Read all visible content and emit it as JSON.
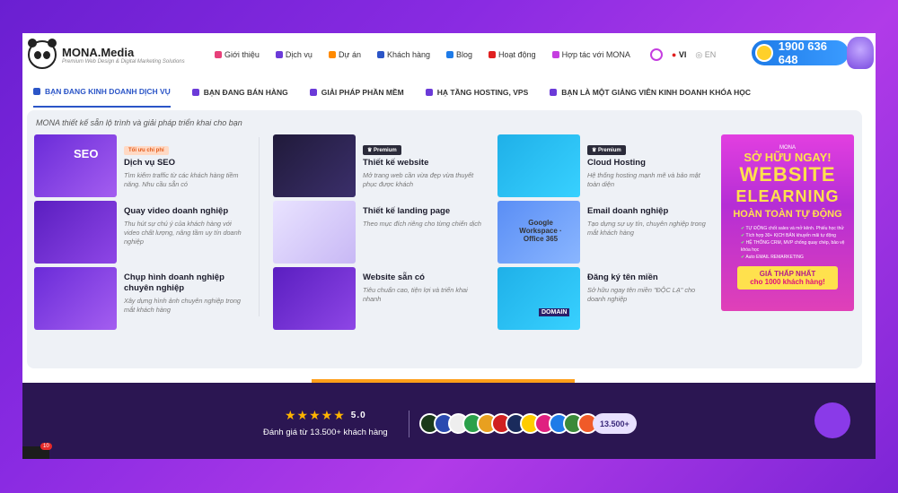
{
  "brand": {
    "name": "MONA",
    "suffix": ".Media",
    "tagline": "Premium Web Design & Digital Marketing Solutions"
  },
  "nav": [
    {
      "label": "Giới thiệu",
      "color": "#e7407a"
    },
    {
      "label": "Dịch vụ",
      "color": "#6b3ad8"
    },
    {
      "label": "Dự án",
      "color": "#ff8a00"
    },
    {
      "label": "Khách hàng",
      "color": "#2b55c7"
    },
    {
      "label": "Blog",
      "color": "#1e7be8"
    },
    {
      "label": "Hoạt động",
      "color": "#e02020"
    },
    {
      "label": "Hợp tác với MONA",
      "color": "#c53ee0"
    }
  ],
  "lang": {
    "vi": "VI",
    "en": "EN"
  },
  "hotline": "1900 636 648",
  "tabs": [
    "BẠN ĐANG KINH DOANH DỊCH VỤ",
    "BẠN ĐANG BÁN HÀNG",
    "GIẢI PHÁP PHẦN MỀM",
    "HẠ TẦNG HOSTING, VPS",
    "BẠN LÀ MỘT GIẢNG VIÊN KINH DOANH KHÓA HỌC"
  ],
  "intro": "MONA thiết kế sẵn lộ trình và giải pháp triển khai cho bạn",
  "col1": [
    {
      "badge": "Tối ưu chi phí",
      "title": "Dịch vụ SEO",
      "desc": "Tìm kiếm traffic từ các khách hàng tiềm năng. Nhu cầu sẵn có",
      "thumb_text": "SEO"
    },
    {
      "title": "Quay video doanh nghiệp",
      "desc": "Thu hút sự chú ý của khách hàng với video chất lượng, nâng tầm uy tín doanh nghiệp"
    },
    {
      "title": "Chụp hình doanh nghiệp chuyên nghiệp",
      "desc": "Xây dựng hình ảnh chuyên nghiệp trong mắt khách hàng"
    }
  ],
  "col2": [
    {
      "badge": "Premium",
      "title": "Thiết kế website",
      "desc": "Mở trang web cần vừa đẹp vừa thuyết phục được khách"
    },
    {
      "title": "Thiết kế landing page",
      "desc": "Theo mục đích riêng cho từng chiến dịch"
    },
    {
      "title": "Website sẵn có",
      "desc": "Tiêu chuẩn cao, tiện lợi và triển khai nhanh"
    }
  ],
  "col3": [
    {
      "badge": "Premium",
      "title": "Cloud Hosting",
      "desc": "Hệ thống hosting mạnh mẽ và bảo mật toàn diện"
    },
    {
      "title": "Email doanh nghiệp",
      "desc": "Tạo dựng sự uy tín, chuyên nghiệp trong mắt khách hàng",
      "thumb_text": "Google Workspace · Office 365"
    },
    {
      "title": "Đăng ký tên miền",
      "desc": "Sở hữu ngay tên miền \"ĐỘC LẠ\" cho doanh nghiệp",
      "thumb_text": "DOMAIN"
    }
  ],
  "promo": {
    "brand": "MONA",
    "line1": "SỞ HỮU NGAY!",
    "line2": "WEBSITE",
    "line3": "ELEARNING",
    "line4": "HOÀN TOÀN TỰ ĐỘNG",
    "features": [
      "TỰ ĐỘNG chốt sales và mở kênh. Phiếu học thử",
      "Tích hợp 30+ KỊCH BẢN khuyến mãi tự động",
      "HỆ THỐNG CRM, MVP chống quay chép, bảo vệ khóa học",
      "Auto EMAIL REMARKETING"
    ],
    "cta": "GIÁ THẤP NHẤT",
    "cta2": "cho 1000 khách hàng!"
  },
  "rating": {
    "stars": "★★★★★",
    "score": "5.0",
    "text": "Đánh giá từ 13.500+ khách hàng",
    "clients_count": "13.500+"
  },
  "notif_count": "10"
}
